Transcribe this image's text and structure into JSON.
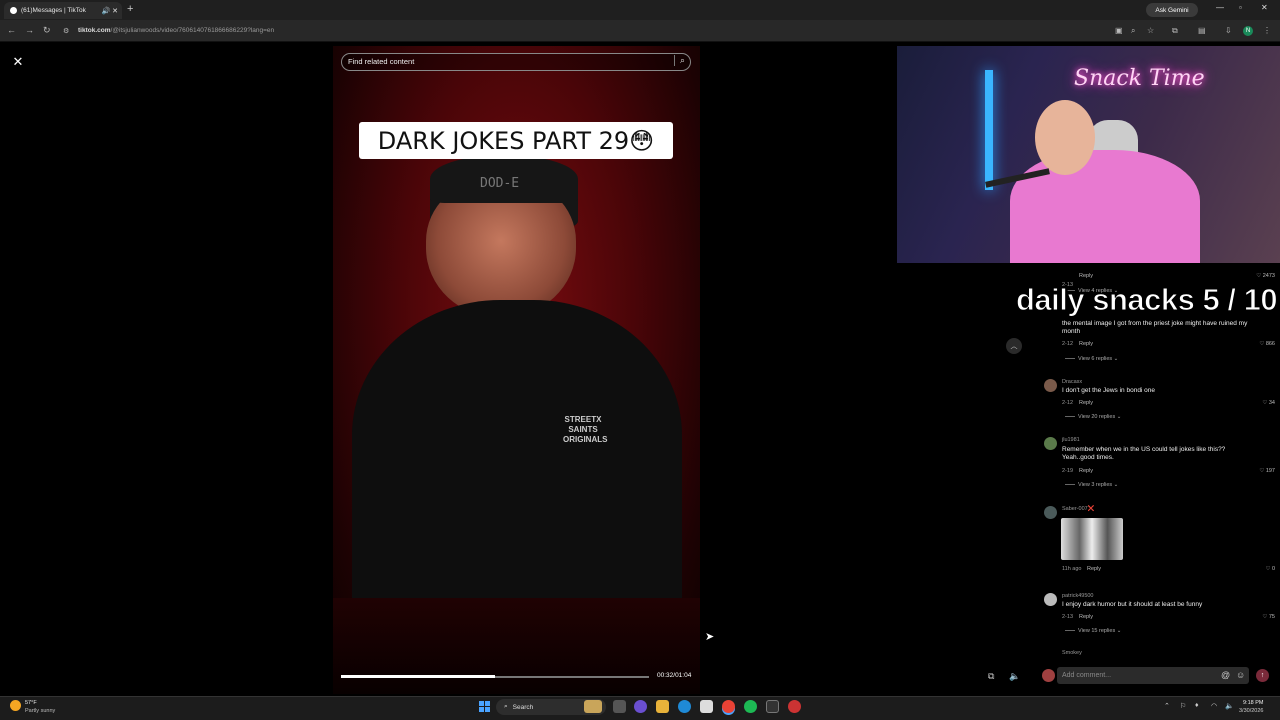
{
  "browser": {
    "tab_title": "(61)Messages | TikTok",
    "new_tab": "+",
    "gemini_label": "Ask Gemini",
    "url_domain": "tiktok.com",
    "url_path": "/@itsjulianwoods/video/7606140761866686229?lang=en",
    "profile_initial": "N"
  },
  "video": {
    "search_placeholder": "Find related content",
    "caption": "DARK JOKES PART 29😳",
    "cap_text": "DOD-E",
    "shirt_text": "STREETX SAINTS ORIGINALS",
    "progress": 0.5,
    "time": "00:32/01:04"
  },
  "overlay": {
    "daily": "daily snacks  5 / 10",
    "neon_sign": "Snack Time"
  },
  "comments": [
    {
      "user": "",
      "text": "",
      "date": "2-13",
      "reply": "Reply",
      "likes": "2473",
      "view": "View 4 replies"
    },
    {
      "user": "",
      "text": "the mental image I got from the priest joke might have ruined my month",
      "date": "2-12",
      "reply": "Reply",
      "likes": "866",
      "view": "View 6 replies"
    },
    {
      "user": "Dracasx",
      "text": "I don't get the Jews in bondi one",
      "date": "2-12",
      "reply": "Reply",
      "likes": "34",
      "view": "View 20 replies"
    },
    {
      "user": "jlu1981",
      "text": "Remember when we in the US could tell jokes like this?? Yeah..good times.",
      "date": "2-19",
      "reply": "Reply",
      "likes": "197",
      "view": "View 3 replies"
    },
    {
      "user": "Saber-007❌",
      "text": "",
      "date": "11h ago",
      "reply": "Reply",
      "likes": "0",
      "view": ""
    },
    {
      "user": "patrick49500",
      "text": "I enjoy dark humor but it should at least be funny",
      "date": "2-13",
      "reply": "Reply",
      "likes": "75",
      "view": "View 15 replies"
    },
    {
      "user": "Smokey",
      "text": "",
      "date": "",
      "reply": "",
      "likes": "",
      "view": ""
    }
  ],
  "comment_input_placeholder": "Add comment...",
  "taskbar": {
    "weather_temp": "57°F",
    "weather_cond": "Partly sunny",
    "search_label": "Search",
    "clock_time": "9:18 PM",
    "clock_date": "3/30/2026"
  },
  "colors": {
    "accent_red": "#7a0c10",
    "taskbar": "#1c1c1c"
  }
}
